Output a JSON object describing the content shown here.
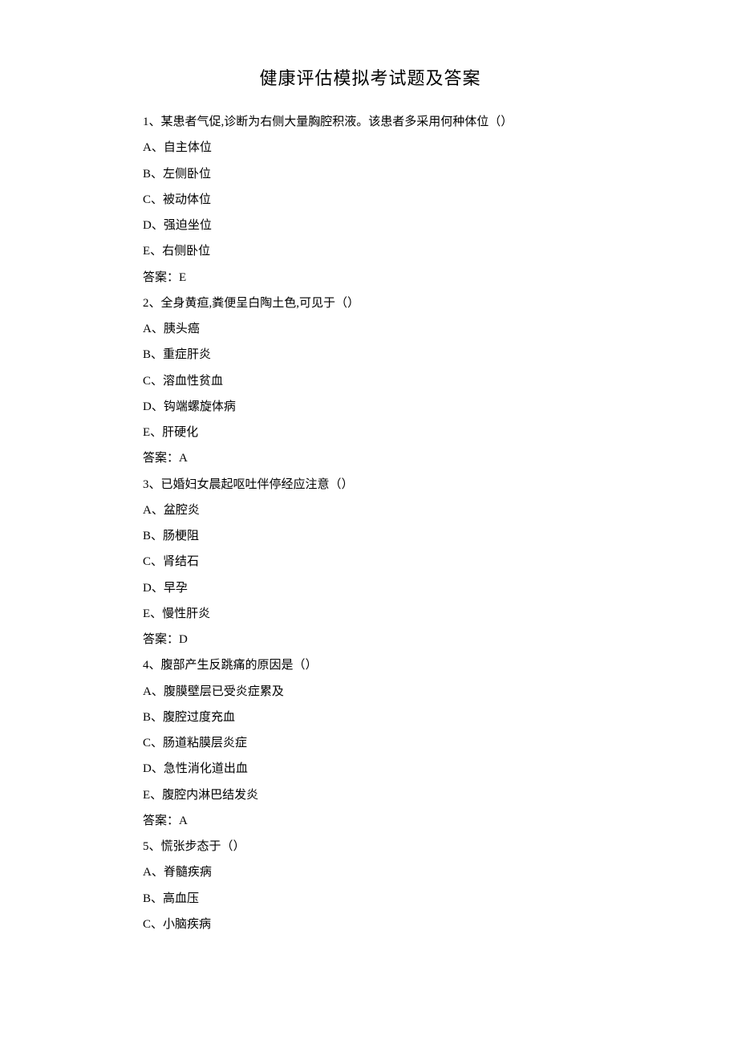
{
  "title": "健康评估模拟考试题及答案",
  "answer_label": "答案：",
  "questions": [
    {
      "stem": "1、某患者气促,诊断为右侧大量胸腔积液。该患者多采用何种体位（）",
      "options": [
        "A、自主体位",
        "B、左侧卧位",
        "C、被动体位",
        "D、强迫坐位",
        "E、右侧卧位"
      ],
      "answer": "E"
    },
    {
      "stem": "2、全身黄疸,粪便呈白陶土色,可见于（）",
      "options": [
        "A、胰头癌",
        "B、重症肝炎",
        "C、溶血性贫血",
        "D、钩端螺旋体病",
        "E、肝硬化"
      ],
      "answer": "A"
    },
    {
      "stem": "3、已婚妇女晨起呕吐伴停经应注意（）",
      "options": [
        "A、盆腔炎",
        "B、肠梗阻",
        "C、肾结石",
        "D、早孕",
        "E、慢性肝炎"
      ],
      "answer": "D"
    },
    {
      "stem": "4、腹部产生反跳痛的原因是（）",
      "options": [
        "A、腹膜壁层已受炎症累及",
        "B、腹腔过度充血",
        "C、肠道粘膜层炎症",
        "D、急性消化道出血",
        "E、腹腔内淋巴结发炎"
      ],
      "answer": "A"
    },
    {
      "stem": "5、慌张步态于（）",
      "options": [
        "A、脊髓疾病",
        "B、高血压",
        "C、小脑疾病"
      ],
      "answer": ""
    }
  ]
}
